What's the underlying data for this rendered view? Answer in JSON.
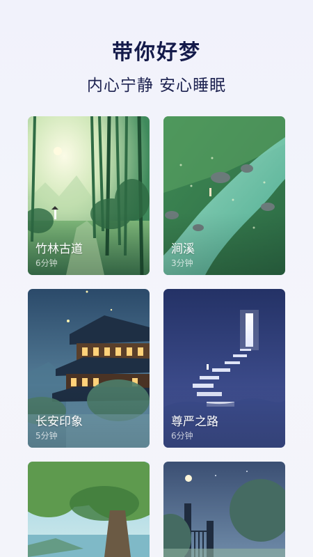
{
  "header": {
    "title": "带你好梦",
    "subtitle": "内心宁静 安心睡眠"
  },
  "cards": [
    {
      "name": "竹林古道",
      "duration": "6分钟",
      "art": "bamboo-forest-path"
    },
    {
      "name": "涧溪",
      "duration": "3分钟",
      "art": "mountain-stream"
    },
    {
      "name": "长安印象",
      "duration": "5分钟",
      "art": "chinese-pavilion-night"
    },
    {
      "name": "尊严之路",
      "duration": "6分钟",
      "art": "stairway-to-door"
    },
    {
      "name": "",
      "duration": "",
      "art": "big-tree-lake"
    },
    {
      "name": "",
      "duration": "",
      "art": "night-gate-moon"
    }
  ]
}
